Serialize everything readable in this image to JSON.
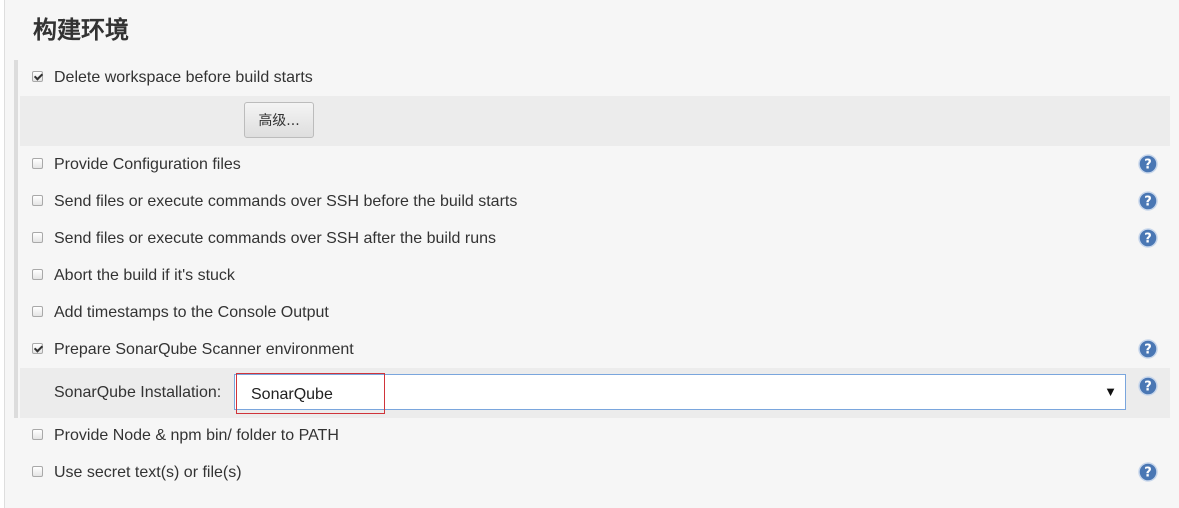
{
  "section": {
    "title": "构建环境"
  },
  "options": [
    {
      "label": "Delete workspace before build starts",
      "checked": true,
      "help": false
    },
    {
      "label": "Provide Configuration files",
      "checked": false,
      "help": true
    },
    {
      "label": "Send files or execute commands over SSH before the build starts",
      "checked": false,
      "help": true
    },
    {
      "label": "Send files or execute commands over SSH after the build runs",
      "checked": false,
      "help": true
    },
    {
      "label": "Abort the build if it's stuck",
      "checked": false,
      "help": false
    },
    {
      "label": "Add timestamps to the Console Output",
      "checked": false,
      "help": false
    },
    {
      "label": "Prepare SonarQube Scanner environment",
      "checked": true,
      "help": true
    },
    {
      "label": "Provide Node & npm bin/ folder to PATH",
      "checked": false,
      "help": false
    },
    {
      "label": "Use secret text(s) or file(s)",
      "checked": false,
      "help": true
    }
  ],
  "advanced": {
    "label": "高级..."
  },
  "sonarqube": {
    "installation_label": "SonarQube Installation:",
    "selected_value": "SonarQube"
  },
  "icons": {
    "help": "help-icon",
    "dropdown": "chevron-down-icon",
    "checkbox": "checkbox"
  },
  "colors": {
    "help_icon": "#4a77b4",
    "select_border": "#7aa6dd",
    "highlight_box": "#d0343a"
  }
}
